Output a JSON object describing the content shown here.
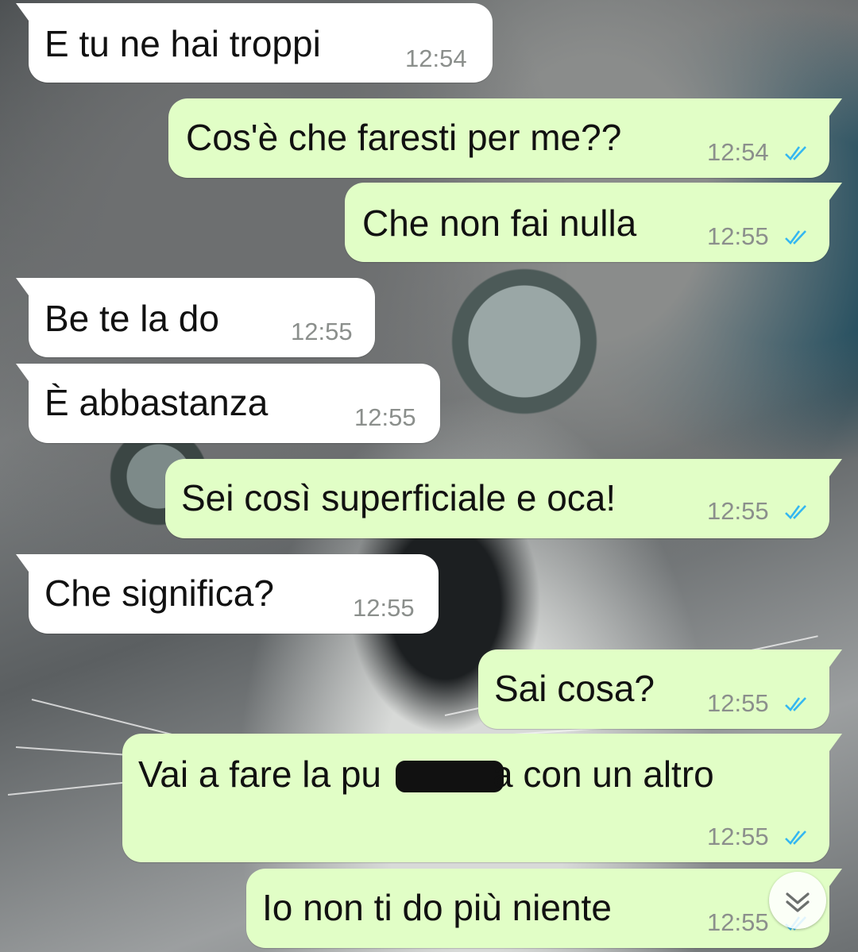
{
  "colors": {
    "incoming_bubble": "#ffffff",
    "outgoing_bubble": "#e1fec6",
    "timestamp": "#8b8f8c",
    "read_ticks": "#34b7f1"
  },
  "wallpaper": {
    "icon": "kitten-photo-wallpaper"
  },
  "messages": [
    {
      "direction": "in",
      "text": "E tu ne hai troppi",
      "time": "12:54"
    },
    {
      "direction": "out",
      "text": "Cos'è che faresti per me??",
      "time": "12:54",
      "status": "read"
    },
    {
      "direction": "out",
      "text": "Che non fai nulla",
      "time": "12:55",
      "status": "read"
    },
    {
      "direction": "in",
      "text": "Be te la do",
      "time": "12:55"
    },
    {
      "direction": "in",
      "text": "È abbastanza",
      "time": "12:55"
    },
    {
      "direction": "out",
      "text": "Sei così superficiale e oca!",
      "time": "12:55",
      "status": "read"
    },
    {
      "direction": "in",
      "text": "Che significa?",
      "time": "12:55"
    },
    {
      "direction": "out",
      "text": "Sai cosa?",
      "time": "12:55",
      "status": "read"
    },
    {
      "direction": "out",
      "text_before": "Vai a fare la pu",
      "text_after": "a con un altro",
      "redacted": true,
      "time": "12:55",
      "status": "read"
    },
    {
      "direction": "out",
      "text": "Io non ti do più niente",
      "time": "12:55",
      "status": "read"
    }
  ],
  "scroll_button": {
    "icon": "double-chevron-down-icon"
  }
}
